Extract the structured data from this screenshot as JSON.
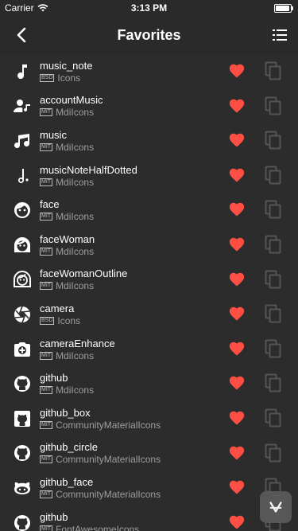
{
  "status": {
    "carrier": "Carrier",
    "time": "3:13 PM"
  },
  "nav": {
    "title": "Favorites"
  },
  "colors": {
    "background": "#2c2c2c",
    "navbar": "#2a2a2a",
    "heart": "#ff4f44"
  },
  "items": [
    {
      "name": "music_note",
      "license": "BSD",
      "lib": "Icons",
      "icon": "music-note-icon"
    },
    {
      "name": "accountMusic",
      "license": "MIT",
      "lib": "MdiIcons",
      "icon": "account-music-icon"
    },
    {
      "name": "music",
      "license": "MIT",
      "lib": "MdiIcons",
      "icon": "music-icon"
    },
    {
      "name": "musicNoteHalfDotted",
      "license": "MIT",
      "lib": "MdiIcons",
      "icon": "music-note-half-dotted-icon"
    },
    {
      "name": "face",
      "license": "MIT",
      "lib": "MdiIcons",
      "icon": "face-icon"
    },
    {
      "name": "faceWoman",
      "license": "MIT",
      "lib": "MdiIcons",
      "icon": "face-woman-icon"
    },
    {
      "name": "faceWomanOutline",
      "license": "MIT",
      "lib": "MdiIcons",
      "icon": "face-woman-outline-icon"
    },
    {
      "name": "camera",
      "license": "BSD",
      "lib": "Icons",
      "icon": "camera-icon"
    },
    {
      "name": "cameraEnhance",
      "license": "MIT",
      "lib": "MdiIcons",
      "icon": "camera-enhance-icon"
    },
    {
      "name": "github",
      "license": "MIT",
      "lib": "MdiIcons",
      "icon": "github-icon"
    },
    {
      "name": "github_box",
      "license": "MIT",
      "lib": "CommunityMaterialIcons",
      "icon": "github-box-icon"
    },
    {
      "name": "github_circle",
      "license": "MIT",
      "lib": "CommunityMaterialIcons",
      "icon": "github-circle-icon"
    },
    {
      "name": "github_face",
      "license": "MIT",
      "lib": "CommunityMaterialIcons",
      "icon": "github-face-icon"
    },
    {
      "name": "github",
      "license": "MIT",
      "lib": "FontAwesomeIcons",
      "icon": "github-icon"
    }
  ]
}
